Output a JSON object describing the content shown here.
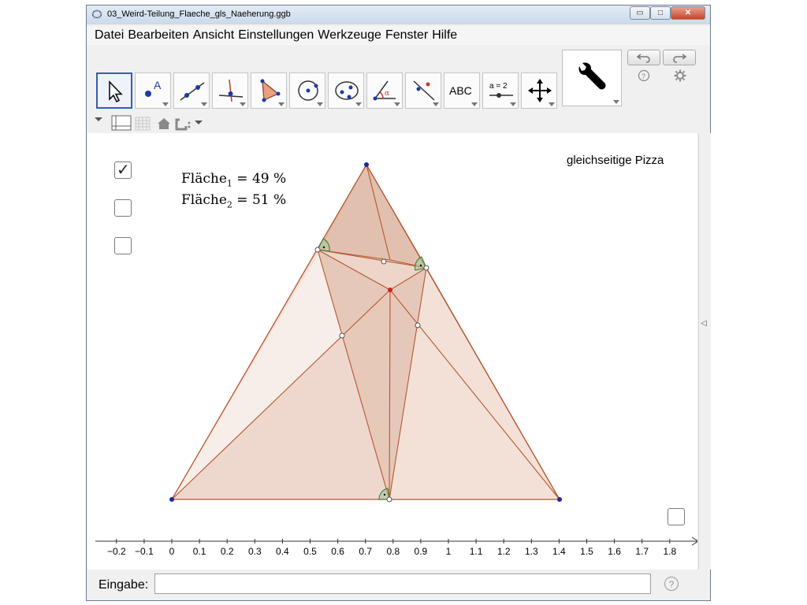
{
  "window": {
    "title": "03_Weird-Teilung_Flaeche_gls_Naeherung.ggb"
  },
  "window_buttons": {
    "minimize": "▭",
    "maximize": "□",
    "close": "✕"
  },
  "menu": [
    "Datei",
    "Bearbeiten",
    "Ansicht",
    "Einstellungen",
    "Werkzeuge",
    "Fenster",
    "Hilfe"
  ],
  "toolbar": {
    "tools": [
      {
        "name": "move-tool",
        "icon": "arrow-cursor-icon"
      },
      {
        "name": "point-tool",
        "icon": "point-a-icon",
        "label": "A"
      },
      {
        "name": "line-tool",
        "icon": "line-icon"
      },
      {
        "name": "perpendicular-tool",
        "icon": "perpendicular-icon"
      },
      {
        "name": "polygon-tool",
        "icon": "polygon-icon"
      },
      {
        "name": "circle-tool",
        "icon": "circle-icon"
      },
      {
        "name": "conic-tool",
        "icon": "ellipse-icon"
      },
      {
        "name": "angle-tool",
        "icon": "angle-icon",
        "label": "α"
      },
      {
        "name": "reflect-tool",
        "icon": "reflect-icon"
      },
      {
        "name": "text-tool",
        "icon": "text-icon",
        "label": "ABC"
      },
      {
        "name": "slider-tool",
        "icon": "slider-icon",
        "label": "a = 2"
      },
      {
        "name": "move-view-tool",
        "icon": "move-arrows-icon"
      }
    ]
  },
  "graphics": {
    "checkboxes": [
      {
        "checked": true,
        "mark": "✓"
      },
      {
        "checked": false
      },
      {
        "checked": false
      },
      {
        "checked": false
      }
    ],
    "area1": {
      "label": "Fläche",
      "sub": "1",
      "value": " = 49 %"
    },
    "area2": {
      "label": "Fläche",
      "sub": "2",
      "value": " = 51 %"
    },
    "title_label": "gleichseitige Pizza",
    "x_ticks": [
      "−0.2",
      "−0.1",
      "0",
      "0.1",
      "0.2",
      "0.3",
      "0.4",
      "0.5",
      "0.6",
      "0.7",
      "0.8",
      "0.9",
      "1",
      "1.1",
      "1.2",
      "1.3",
      "1.4",
      "1.5",
      "1.6",
      "1.7",
      "1.8"
    ],
    "colors": {
      "fill": "#d4a08a",
      "stroke": "#b5572e",
      "vertex": "#1a2a9a",
      "center": "#cc2222",
      "angle": "#2f7a2f"
    }
  },
  "input_bar": {
    "label": "Eingabe:",
    "value": "",
    "help": "?"
  }
}
